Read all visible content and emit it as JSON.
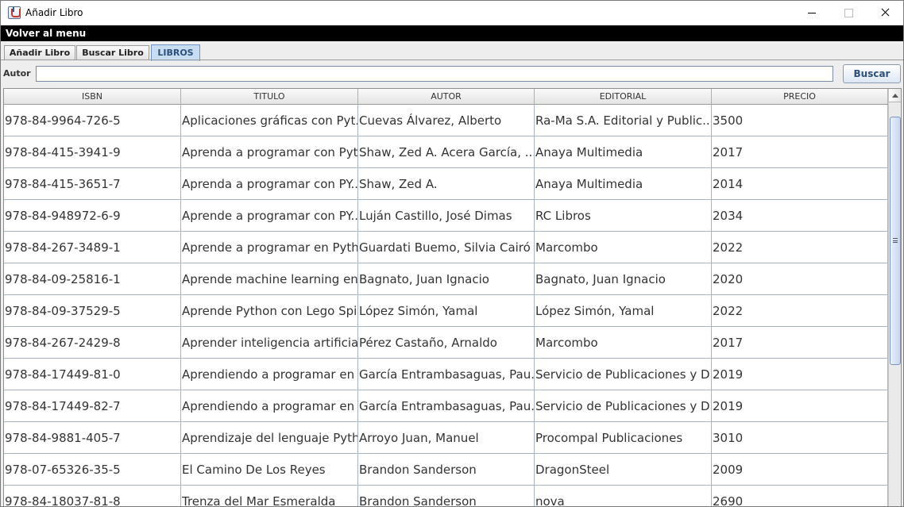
{
  "window": {
    "title": "Añadir Libro"
  },
  "menu": {
    "back_label": "Volver al menu"
  },
  "tabs": [
    {
      "label": "Añadir Libro"
    },
    {
      "label": "Buscar Libro"
    },
    {
      "label": "LIBROS"
    }
  ],
  "search": {
    "label": "Autor",
    "value": "",
    "button_label": "Buscar"
  },
  "table": {
    "columns": [
      "ISBN",
      "TITULO",
      "AUTOR",
      "EDITORIAL",
      "PRECIO"
    ],
    "rows": [
      [
        "978-84-9964-726-5",
        "Aplicaciones gráficas con Pyt...",
        "Cuevas Álvarez, Alberto",
        "Ra-Ma S.A. Editorial y Public...",
        "3500"
      ],
      [
        "978-84-415-3941-9",
        "Aprenda a programar con Pyt...",
        "Shaw, Zed A. Acera García, ...",
        "Anaya Multimedia",
        "2017"
      ],
      [
        "978-84-415-3651-7",
        "Aprenda a programar con PY...",
        "Shaw, Zed A.",
        "Anaya Multimedia",
        "2014"
      ],
      [
        "978-84-948972-6-9",
        "Aprende a programar con PY...",
        "Luján Castillo, José Dimas",
        "RC Libros",
        "2034"
      ],
      [
        "978-84-267-3489-1",
        "Aprende a programar en Pyth...",
        "Guardati Buemo, Silvia Cairó ...",
        "Marcombo",
        "2022"
      ],
      [
        "978-84-09-25816-1",
        "Aprende machine learning en ...",
        "Bagnato, Juan Ignacio",
        "Bagnato, Juan Ignacio",
        "2020"
      ],
      [
        "978-84-09-37529-5",
        "Aprende Python con Lego Spi...",
        "López Simón, Yamal",
        "López Simón, Yamal",
        "2022"
      ],
      [
        "978-84-267-2429-8",
        "Aprender inteligencia artificial...",
        "Pérez Castaño, Arnaldo",
        "Marcombo",
        "2017"
      ],
      [
        "978-84-17449-81-0",
        "Aprendiendo a programar en ...",
        "García Entrambasaguas, Pau...",
        "Servicio de Publicaciones y D...",
        "2019"
      ],
      [
        "978-84-17449-82-7",
        "Aprendiendo a programar en ...",
        "García Entrambasaguas, Pau...",
        "Servicio de Publicaciones y D...",
        "2019"
      ],
      [
        "978-84-9881-405-7",
        "Aprendizaje del lenguaje Pyth...",
        "Arroyo Juan, Manuel",
        "Procompal Publicaciones",
        "3010"
      ],
      [
        "978-07-65326-35-5",
        "El Camino De Los Reyes",
        "Brandon Sanderson",
        "DragonSteel",
        "2009"
      ],
      [
        "978-84-18037-81-8",
        "Trenza del Mar Esmeralda",
        "Brandon Sanderson",
        "nova",
        "2690"
      ]
    ]
  },
  "icons": {
    "app": "java-icon",
    "minimize": "minimize-icon",
    "maximize": "maximize-icon",
    "close": "close-icon"
  }
}
